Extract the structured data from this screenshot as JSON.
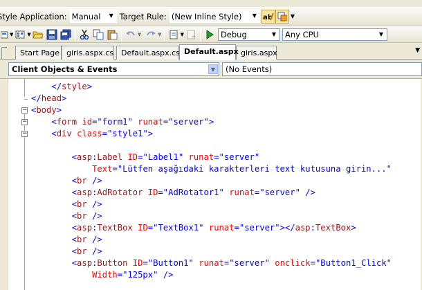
{
  "style_toolbar": {
    "style_application_label": "Style Application:",
    "style_application_value": "Manual",
    "target_rule_label": "Target Rule:",
    "target_rule_value": "(New Inline Style)"
  },
  "standard_toolbar": {
    "configuration_value": "Debug",
    "platform_value": "Any CPU"
  },
  "tabs": [
    {
      "label": "Start Page"
    },
    {
      "label": "giris.aspx.cs"
    },
    {
      "label": "Default.aspx.cs"
    },
    {
      "label": "Default.aspx"
    },
    {
      "label": "giris.aspx"
    }
  ],
  "tab_menu_arrow": "▼",
  "events_bar": {
    "objects_value": "Client Objects & Events",
    "events_value": "(No Events)"
  },
  "code_lines": [
    {
      "indent": "    ",
      "parts": [
        [
          "b",
          "</"
        ],
        [
          "t",
          "style"
        ],
        [
          "b",
          ">"
        ]
      ]
    },
    {
      "indent": "",
      "parts": [
        [
          "b",
          "</"
        ],
        [
          "t",
          "head"
        ],
        [
          "b",
          ">"
        ]
      ]
    },
    {
      "indent": "",
      "parts": [
        [
          "b",
          "<"
        ],
        [
          "t",
          "body"
        ],
        [
          "b",
          ">"
        ]
      ]
    },
    {
      "indent": "    ",
      "parts": [
        [
          "b",
          "<"
        ],
        [
          "t",
          "form "
        ],
        [
          "a",
          "id"
        ],
        [
          "b",
          "=\"form1\" "
        ],
        [
          "a",
          "runat"
        ],
        [
          "b",
          "=\"server\">"
        ]
      ]
    },
    {
      "indent": "    ",
      "parts": [
        [
          "b",
          "<"
        ],
        [
          "t",
          "div "
        ],
        [
          "a",
          "class"
        ],
        [
          "b",
          "=\"style1\">"
        ]
      ]
    },
    {
      "indent": "",
      "parts": []
    },
    {
      "indent": "        ",
      "parts": [
        [
          "b",
          "<"
        ],
        [
          "t",
          "asp"
        ],
        [
          "b",
          ":"
        ],
        [
          "t",
          "Label "
        ],
        [
          "a",
          "ID"
        ],
        [
          "b",
          "=\"Label1\" "
        ],
        [
          "a",
          "runat"
        ],
        [
          "b",
          "=\"server\""
        ]
      ]
    },
    {
      "indent": "            ",
      "parts": [
        [
          "a",
          "Text"
        ],
        [
          "b",
          "=\"Lütfen aşağıdaki karakterleri text kutusuna girin...\""
        ]
      ]
    },
    {
      "indent": "        ",
      "parts": [
        [
          "b",
          "<"
        ],
        [
          "t",
          "br "
        ],
        [
          "b",
          "/>"
        ]
      ]
    },
    {
      "indent": "        ",
      "parts": [
        [
          "b",
          "<"
        ],
        [
          "t",
          "asp"
        ],
        [
          "b",
          ":"
        ],
        [
          "t",
          "AdRotator "
        ],
        [
          "a",
          "ID"
        ],
        [
          "b",
          "=\"AdRotator1\" "
        ],
        [
          "a",
          "runat"
        ],
        [
          "b",
          "=\"server\" />"
        ]
      ]
    },
    {
      "indent": "        ",
      "parts": [
        [
          "b",
          "<"
        ],
        [
          "t",
          "br "
        ],
        [
          "b",
          "/>"
        ]
      ]
    },
    {
      "indent": "        ",
      "parts": [
        [
          "b",
          "<"
        ],
        [
          "t",
          "br "
        ],
        [
          "b",
          "/>"
        ]
      ]
    },
    {
      "indent": "        ",
      "parts": [
        [
          "b",
          "<"
        ],
        [
          "t",
          "asp"
        ],
        [
          "b",
          ":"
        ],
        [
          "t",
          "TextBox "
        ],
        [
          "a",
          "ID"
        ],
        [
          "b",
          "=\"TextBox1\" "
        ],
        [
          "a",
          "runat"
        ],
        [
          "b",
          "=\"server\"></"
        ],
        [
          "t",
          "asp"
        ],
        [
          "b",
          ":"
        ],
        [
          "t",
          "TextBox"
        ],
        [
          "b",
          ">"
        ]
      ]
    },
    {
      "indent": "        ",
      "parts": [
        [
          "b",
          "<"
        ],
        [
          "t",
          "br "
        ],
        [
          "b",
          "/>"
        ]
      ]
    },
    {
      "indent": "        ",
      "parts": [
        [
          "b",
          "<"
        ],
        [
          "t",
          "br "
        ],
        [
          "b",
          "/>"
        ]
      ]
    },
    {
      "indent": "        ",
      "parts": [
        [
          "b",
          "<"
        ],
        [
          "t",
          "asp"
        ],
        [
          "b",
          ":"
        ],
        [
          "t",
          "Button "
        ],
        [
          "a",
          "ID"
        ],
        [
          "b",
          "=\"Button1\" "
        ],
        [
          "a",
          "runat"
        ],
        [
          "b",
          "=\"server\" "
        ],
        [
          "a",
          "onclick"
        ],
        [
          "b",
          "=\"Button1_Click\""
        ]
      ]
    },
    {
      "indent": "            ",
      "parts": [
        [
          "a",
          "Width"
        ],
        [
          "b",
          "=\"125px\" />"
        ]
      ]
    }
  ],
  "colors": {
    "markup_delimiter": "#0000ff",
    "element_name": "#a31515",
    "attribute_name": "#ff0000",
    "toolbar_bg": "#ece9d8",
    "active_tab": "#ffffff"
  },
  "icons": [
    "new-style-icon",
    "manage-styles-icon",
    "add-item-icon",
    "new-project-icon",
    "open-file-icon",
    "save-icon",
    "save-all-icon",
    "cut-icon",
    "copy-icon",
    "paste-icon",
    "undo-icon",
    "redo-icon",
    "navigate-icon",
    "start-debug-icon"
  ]
}
